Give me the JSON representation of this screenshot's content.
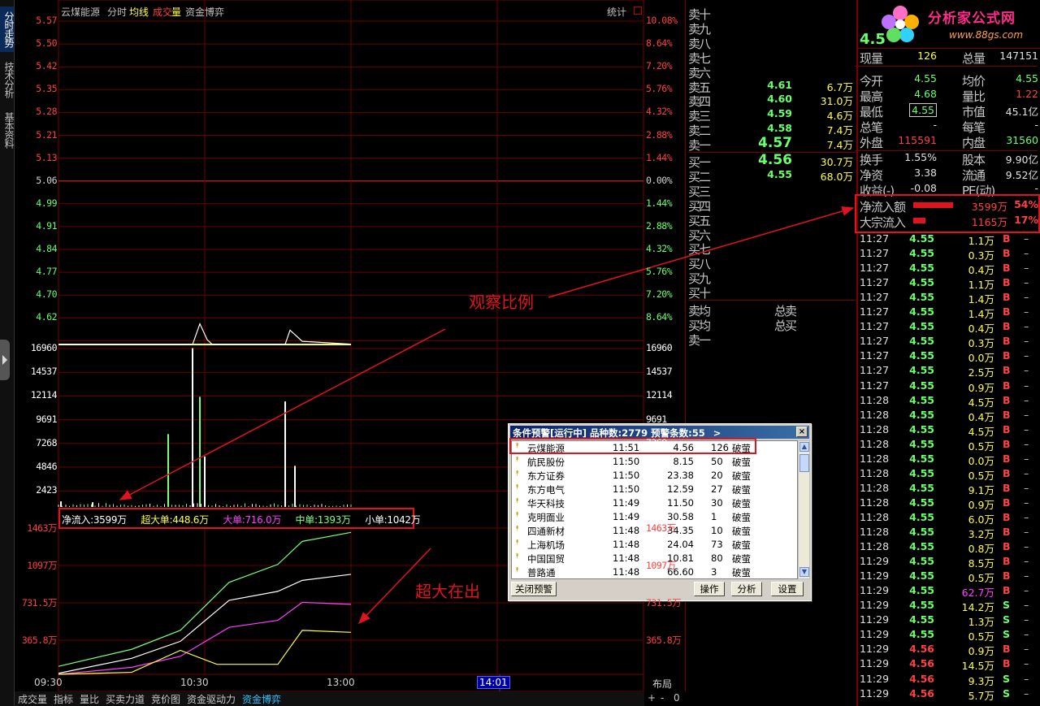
{
  "tabs_left": [
    "分时走势",
    "技术分析",
    "基本资料"
  ],
  "chart_header": {
    "name": "云煤能源",
    "items": [
      "分时",
      "均线",
      "成交",
      "量",
      "资金博弈"
    ],
    "stat": "统计"
  },
  "price_axis": [
    "5.57",
    "5.50",
    "5.42",
    "5.35",
    "5.28",
    "5.21",
    "5.13",
    "5.06",
    "4.99",
    "4.91",
    "4.84",
    "4.77",
    "4.70",
    "4.62"
  ],
  "pct_axis": [
    "10.08%",
    "8.64%",
    "7.20%",
    "5.76%",
    "4.32%",
    "2.88%",
    "1.44%",
    "0.00%",
    "1.44%",
    "2.88%",
    "4.32%",
    "5.76%",
    "7.20%",
    "8.64%"
  ],
  "volume_axis": [
    "16960",
    "14537",
    "12114",
    "9691",
    "7268",
    "4846",
    "2423"
  ],
  "flow_axis": [
    "1463万",
    "1097万",
    "731.5万",
    "365.8万"
  ],
  "flow_legend": {
    "net": "净流入:3599万",
    "super": "超大单:448.6万",
    "large": "大单:716.0万",
    "mid": "中单:1393万",
    "small": "小单:1042万"
  },
  "annotations": {
    "ratio": "观察比例",
    "super_out": "超大在出"
  },
  "time_axis": {
    "t1": "09:30",
    "t2": "10:30",
    "t3": "13:00",
    "cursor": "14:01",
    "layout": "布局"
  },
  "bottom_tabs": [
    "成交量",
    "指标",
    "量比",
    "买卖力道",
    "竞价图",
    "资金驱动力",
    "资金博弈"
  ],
  "bottom_controls": [
    "+",
    "-",
    "0"
  ],
  "colors": {
    "bg": "#000000",
    "grid": "#7a0000",
    "price_up": "#ff4040",
    "price_down": "#6cff6c",
    "volume": "#ffff40",
    "cursor": "#3030ff"
  },
  "orderbook": {
    "sell": [
      {
        "label": "卖十",
        "price": "",
        "vol": ""
      },
      {
        "label": "卖九",
        "price": "",
        "vol": ""
      },
      {
        "label": "卖八",
        "price": "",
        "vol": ""
      },
      {
        "label": "卖七",
        "price": "",
        "vol": ""
      },
      {
        "label": "卖六",
        "price": "",
        "vol": ""
      },
      {
        "label": "卖五",
        "price": "4.61",
        "vol": "6.7万"
      },
      {
        "label": "卖四",
        "price": "4.60",
        "vol": "31.0万"
      },
      {
        "label": "卖三",
        "price": "4.59",
        "vol": "4.6万"
      },
      {
        "label": "卖二",
        "price": "4.58",
        "vol": "7.4万"
      },
      {
        "label": "卖一",
        "price": "4.57",
        "vol": "7.4万"
      }
    ],
    "buy": [
      {
        "label": "买一",
        "price": "4.56",
        "vol": "30.7万"
      },
      {
        "label": "买二",
        "price": "4.55",
        "vol": "68.0万"
      },
      {
        "label": "买三",
        "price": "",
        "vol": ""
      },
      {
        "label": "买四",
        "price": "",
        "vol": ""
      },
      {
        "label": "买五",
        "price": "",
        "vol": ""
      },
      {
        "label": "买六",
        "price": "",
        "vol": ""
      },
      {
        "label": "买七",
        "price": "",
        "vol": ""
      },
      {
        "label": "买八",
        "price": "",
        "vol": ""
      },
      {
        "label": "买九",
        "price": "",
        "vol": ""
      },
      {
        "label": "买十",
        "price": "",
        "vol": ""
      }
    ],
    "avg": [
      {
        "label": "卖均",
        "total": "总卖"
      },
      {
        "label": "买均",
        "total": "总买"
      },
      {
        "label": "卖一",
        "total": ""
      }
    ]
  },
  "logo": {
    "text": "分析家公式网",
    "url": "www.88gs.com"
  },
  "quote": {
    "price_partial": "4.5",
    "rows": [
      {
        "k1": "现量",
        "v1": "126",
        "k2": "总量",
        "v2": "147151"
      },
      {
        "k1": "今开",
        "v1": "4.55",
        "k2": "均价",
        "v2": "4.55"
      },
      {
        "k1": "最高",
        "v1": "4.68",
        "k2": "量比",
        "v2": "1.22"
      },
      {
        "k1": "最低",
        "v1": "4.55",
        "k2": "市值",
        "v2": "45.1亿"
      },
      {
        "k1": "总笔",
        "v1": "-",
        "k2": "每笔",
        "v2": "-"
      },
      {
        "k1": "外盘",
        "v1": "115591",
        "k2": "内盘",
        "v2": "31560"
      },
      {
        "k1": "换手",
        "v1": "1.55%",
        "k2": "股本",
        "v2": "9.90亿"
      },
      {
        "k1": "净资",
        "v1": "3.38",
        "k2": "流通",
        "v2": "9.52亿"
      },
      {
        "k1": "收益(-)",
        "v1": "-0.08",
        "k2": "PE(动)",
        "v2": "-"
      }
    ],
    "flows": [
      {
        "k": "净流入额",
        "v": "3599万",
        "pct": "54%",
        "bar": 0.54
      },
      {
        "k": "大宗流入",
        "v": "1165万",
        "pct": "17%",
        "bar": 0.17
      }
    ]
  },
  "ticks": [
    {
      "t": "11:27",
      "p": "4.55",
      "v": "1.1万",
      "bs": "B"
    },
    {
      "t": "11:27",
      "p": "4.55",
      "v": "0.3万",
      "bs": "B"
    },
    {
      "t": "11:27",
      "p": "4.55",
      "v": "0.4万",
      "bs": "B"
    },
    {
      "t": "11:27",
      "p": "4.55",
      "v": "1.1万",
      "bs": "B"
    },
    {
      "t": "11:27",
      "p": "4.55",
      "v": "1.4万",
      "bs": "B"
    },
    {
      "t": "11:27",
      "p": "4.55",
      "v": "1.4万",
      "bs": "B"
    },
    {
      "t": "11:27",
      "p": "4.55",
      "v": "0.4万",
      "bs": "B"
    },
    {
      "t": "11:27",
      "p": "4.55",
      "v": "0.3万",
      "bs": "B"
    },
    {
      "t": "11:27",
      "p": "4.55",
      "v": "0.0万",
      "bs": "B"
    },
    {
      "t": "11:27",
      "p": "4.55",
      "v": "2.5万",
      "bs": "B"
    },
    {
      "t": "11:27",
      "p": "4.55",
      "v": "0.9万",
      "bs": "B"
    },
    {
      "t": "11:28",
      "p": "4.55",
      "v": "4.5万",
      "bs": "B"
    },
    {
      "t": "11:28",
      "p": "4.55",
      "v": "0.4万",
      "bs": "B"
    },
    {
      "t": "11:28",
      "p": "4.55",
      "v": "4.5万",
      "bs": "B"
    },
    {
      "t": "11:28",
      "p": "4.55",
      "v": "0.5万",
      "bs": "B"
    },
    {
      "t": "11:28",
      "p": "4.55",
      "v": "0.0万",
      "bs": "B"
    },
    {
      "t": "11:28",
      "p": "4.55",
      "v": "0.5万",
      "bs": "B"
    },
    {
      "t": "11:28",
      "p": "4.55",
      "v": "9.1万",
      "bs": "B"
    },
    {
      "t": "11:28",
      "p": "4.55",
      "v": "0.9万",
      "bs": "B"
    },
    {
      "t": "11:28",
      "p": "4.55",
      "v": "6.0万",
      "bs": "B"
    },
    {
      "t": "11:28",
      "p": "4.55",
      "v": "3.2万",
      "bs": "B"
    },
    {
      "t": "11:28",
      "p": "4.55",
      "v": "0.8万",
      "bs": "B"
    },
    {
      "t": "11:29",
      "p": "4.55",
      "v": "8.5万",
      "bs": "B"
    },
    {
      "t": "11:29",
      "p": "4.55",
      "v": "0.5万",
      "bs": "B"
    },
    {
      "t": "11:29",
      "p": "4.55",
      "v": "62.7万",
      "bs": "B"
    },
    {
      "t": "11:29",
      "p": "4.55",
      "v": "14.2万",
      "bs": "S"
    },
    {
      "t": "11:29",
      "p": "4.55",
      "v": "1.3万",
      "bs": "S"
    },
    {
      "t": "11:29",
      "p": "4.55",
      "v": "0.5万",
      "bs": "S"
    },
    {
      "t": "11:29",
      "p": "4.56",
      "v": "0.9万",
      "bs": "B"
    },
    {
      "t": "11:29",
      "p": "4.56",
      "v": "14.5万",
      "bs": "B"
    },
    {
      "t": "11:29",
      "p": "4.56",
      "v": "9.3万",
      "bs": "S"
    },
    {
      "t": "11:29",
      "p": "4.56",
      "v": "5.7万",
      "bs": "S"
    }
  ],
  "alert": {
    "title": "条件预警[运行中]  品种数:2779  预警条数:55",
    "arrow": ">",
    "close": "×",
    "rows": [
      {
        "name": "云煤能源",
        "time": "11:51",
        "price": "4.56",
        "vol": "126",
        "type": "破萤"
      },
      {
        "name": "航民股份",
        "time": "11:50",
        "price": "8.15",
        "vol": "50",
        "type": "破萤"
      },
      {
        "name": "东方证券",
        "time": "11:50",
        "price": "23.38",
        "vol": "20",
        "type": "破萤"
      },
      {
        "name": "东方电气",
        "time": "11:50",
        "price": "12.59",
        "vol": "27",
        "type": "破萤"
      },
      {
        "name": "华天科技",
        "time": "11:49",
        "price": "11.50",
        "vol": "30",
        "type": "破萤"
      },
      {
        "name": "克明面业",
        "time": "11:49",
        "price": "30.58",
        "vol": "1",
        "type": "破萤"
      },
      {
        "name": "四通新材",
        "time": "11:48",
        "price": "34.35",
        "vol": "10",
        "type": "破萤"
      },
      {
        "name": "上海机场",
        "time": "11:48",
        "price": "24.04",
        "vol": "73",
        "type": "破萤"
      },
      {
        "name": "中国国贸",
        "time": "11:48",
        "price": "10.81",
        "vol": "80",
        "type": "破萤"
      },
      {
        "name": "普路通",
        "time": "11:48",
        "price": "66.60",
        "vol": "3",
        "type": "破萤"
      }
    ],
    "buttons": {
      "close": "关闭预警",
      "op": "操作",
      "analyze": "分析",
      "settings": "设置"
    }
  },
  "chart_data": {
    "type": "line",
    "x_range": [
      "09:30",
      "14:01"
    ],
    "price_ylim": [
      4.55,
      5.57
    ],
    "prev_close": 5.06,
    "price_series": [
      {
        "x": "10:30",
        "y": 4.62
      },
      {
        "x": "11:10",
        "y": 4.6
      }
    ],
    "volume_ylim": [
      0,
      16960
    ],
    "volume_bars": [
      {
        "x": "09:31",
        "v": 600
      },
      {
        "x": "09:44",
        "v": 500
      },
      {
        "x": "10:15",
        "v": 7800
      },
      {
        "x": "10:25",
        "v": 17000
      },
      {
        "x": "10:28",
        "v": 11800
      },
      {
        "x": "10:30",
        "v": 5400
      },
      {
        "x": "11:03",
        "v": 11300
      },
      {
        "x": "11:07",
        "v": 4400
      }
    ],
    "flow_ylim": [
      0,
      1463
    ],
    "flow_series": [
      {
        "name": "中单",
        "color": "#7cff7c",
        "points": [
          [
            "09:30",
            80
          ],
          [
            "10:00",
            250
          ],
          [
            "10:20",
            440
          ],
          [
            "10:40",
            920
          ],
          [
            "11:00",
            1100
          ],
          [
            "11:10",
            1330
          ],
          [
            "11:30",
            1420
          ]
        ]
      },
      {
        "name": "小单",
        "color": "#ffffff",
        "points": [
          [
            "09:30",
            10
          ],
          [
            "10:00",
            160
          ],
          [
            "10:20",
            330
          ],
          [
            "10:40",
            740
          ],
          [
            "11:00",
            830
          ],
          [
            "11:10",
            940
          ],
          [
            "11:30",
            1000
          ]
        ]
      },
      {
        "name": "大单",
        "color": "#ff40ff",
        "points": [
          [
            "09:30",
            0
          ],
          [
            "10:00",
            70
          ],
          [
            "10:20",
            180
          ],
          [
            "10:40",
            470
          ],
          [
            "11:00",
            540
          ],
          [
            "11:10",
            720
          ],
          [
            "11:30",
            700
          ]
        ]
      },
      {
        "name": "超大单",
        "color": "#ffff40",
        "points": [
          [
            "09:30",
            0
          ],
          [
            "10:00",
            20
          ],
          [
            "10:20",
            240
          ],
          [
            "10:35",
            100
          ],
          [
            "11:00",
            100
          ],
          [
            "11:10",
            440
          ],
          [
            "11:30",
            420
          ]
        ]
      }
    ]
  }
}
